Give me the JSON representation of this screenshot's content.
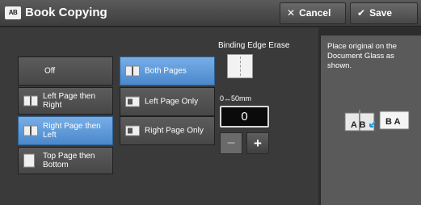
{
  "window": {
    "title": "Book Copying",
    "title_icon": "AB",
    "cancel_label": "Cancel",
    "save_label": "Save"
  },
  "options": {
    "off_label": "Off",
    "left_right_label": "Left Page then Right",
    "right_left_label": "Right Page then Left",
    "top_bottom_label": "Top Page then Bottom"
  },
  "pages": {
    "both_label": "Both Pages",
    "left_only_label": "Left Page Only",
    "right_only_label": "Right Page Only"
  },
  "binding": {
    "title": "Binding Edge Erase",
    "range": "0↔50mm",
    "value": "0",
    "minus": "−",
    "plus": "+"
  },
  "hint": {
    "text": "Place original on the Document Glass as shown.",
    "diagram_left": "A B",
    "diagram_right": "B A"
  },
  "colors": {
    "selected": "#5b98d8",
    "background": "#3a3a3a"
  }
}
